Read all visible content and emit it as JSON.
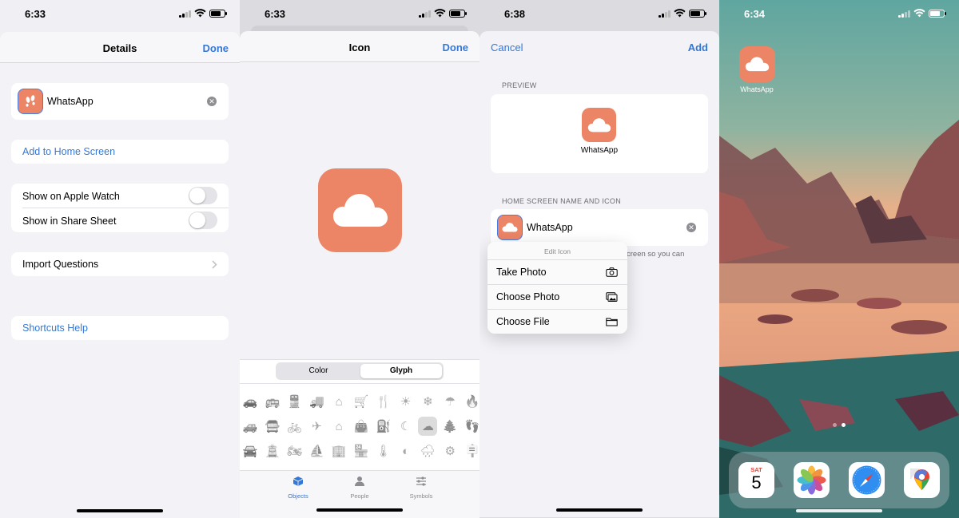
{
  "screen1": {
    "time": "6:33",
    "title": "Details",
    "done": "Done",
    "name_value": "WhatsApp",
    "add_to_home": "Add to Home Screen",
    "show_watch": "Show on Apple Watch",
    "show_share": "Show in Share Sheet",
    "import_questions": "Import Questions",
    "help": "Shortcuts Help"
  },
  "screen2": {
    "time": "6:33",
    "title": "Icon",
    "done": "Done",
    "segments": [
      "Color",
      "Glyph"
    ],
    "selected_segment": "Glyph",
    "tabs": [
      {
        "label": "Objects",
        "icon": "cube-icon"
      },
      {
        "label": "People",
        "icon": "person-icon"
      },
      {
        "label": "Symbols",
        "icon": "sliders-icon"
      }
    ],
    "active_tab": "Objects"
  },
  "screen3": {
    "time": "6:38",
    "cancel": "Cancel",
    "add": "Add",
    "preview_header": "PREVIEW",
    "preview_name": "WhatsApp",
    "name_header": "HOME SCREEN NAME AND ICON",
    "name_value": "WhatsApp",
    "partial_text": "creen so you can",
    "menu_title": "Edit Icon",
    "menu_items": [
      {
        "label": "Take Photo",
        "icon": "camera-icon"
      },
      {
        "label": "Choose Photo",
        "icon": "photo-icon"
      },
      {
        "label": "Choose File",
        "icon": "folder-icon"
      }
    ]
  },
  "screen4": {
    "time": "6:34",
    "app_label": "WhatsApp",
    "calendar_day": "SAT",
    "calendar_date": "5",
    "dock": [
      "calendar-icon",
      "photos-icon",
      "safari-icon",
      "maps-icon"
    ]
  },
  "colors": {
    "accent": "#3478d7",
    "icon_orange": "#ec8466",
    "background": "#f2f2f7"
  }
}
